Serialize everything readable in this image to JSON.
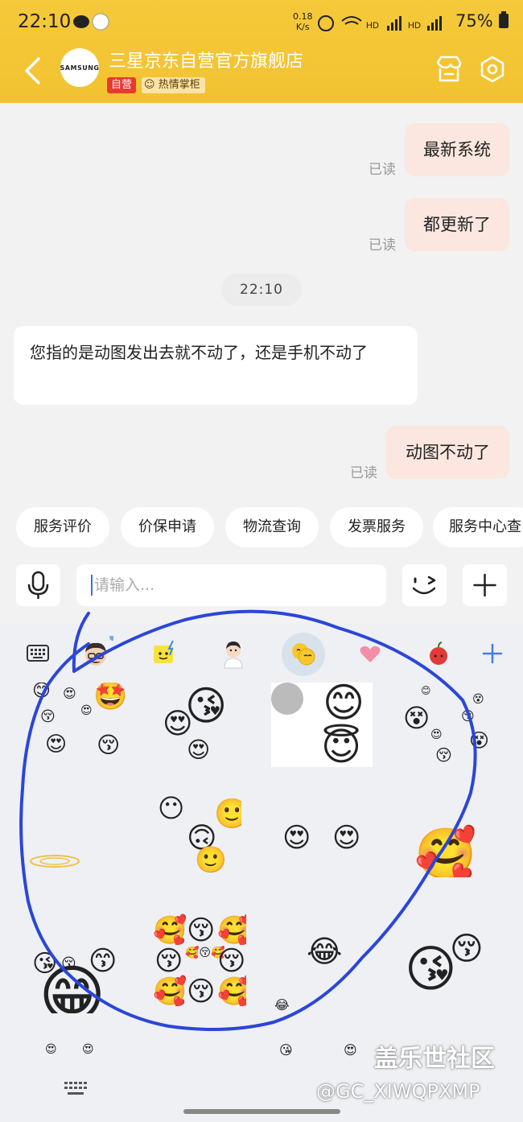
{
  "status_bar": {
    "time": "22:10",
    "speed_value": "0.18",
    "speed_unit": "K/s",
    "network": "HD 5G HD 5G",
    "battery": "75%"
  },
  "header": {
    "avatar_text": "SAMSUNG",
    "store_name": "三星京东自营官方旗舰店",
    "badge_self": "自营",
    "badge_host": "热情掌柜"
  },
  "chat": {
    "messages": [
      {
        "side": "out",
        "text": "最新系统",
        "read": "已读"
      },
      {
        "side": "out",
        "text": "都更新了",
        "read": "已读"
      },
      {
        "side": "time",
        "text": "22:10"
      },
      {
        "side": "in",
        "text": "您指的是动图发出去就不动了，还是手机不动了"
      },
      {
        "side": "out",
        "text": "动图不动了",
        "read": "已读"
      }
    ]
  },
  "quick_chips": [
    "服务评价",
    "价保申请",
    "物流查询",
    "发票服务",
    "服务中心查"
  ],
  "input": {
    "placeholder": "请输入..."
  },
  "sticker_tabs": [
    "keyboard-icon",
    "avatar-sticker-icon",
    "lightning-sticker-icon",
    "person-sticker-icon",
    "emoji-sticker-icon",
    "heart-sticker-icon",
    "apple-sticker-icon",
    "add-icon"
  ],
  "watermark": {
    "line1": "盖乐世社区",
    "line2": "@GC_XIWQPXMP"
  },
  "colors": {
    "header": "#f2c230",
    "out_bubble": "#fbe7df",
    "annotation": "#2b46d8"
  }
}
